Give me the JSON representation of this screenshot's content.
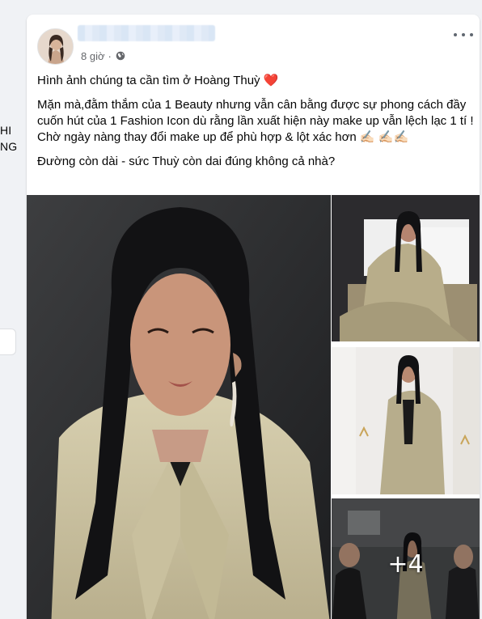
{
  "left_sidebar": {
    "fragment_1": "HI",
    "fragment_2": "NG"
  },
  "post": {
    "author_name": "████████████",
    "timestamp": "8 giờ",
    "separator": "·",
    "privacy_icon": "globe-icon",
    "more_icon": "more-horizontal-icon",
    "paragraphs": [
      "Hình ảnh chúng ta cần tìm ở Hoàng Thuỳ",
      "Mặn mà,đằm thắm của 1 Beauty nhưng vẫn cân bằng được sự phong cách đầy cuốn hút của 1 Fashion Icon dù rằng lần xuất hiện này make up vẫn lệch lạc 1 tí ! Chờ ngày nàng thay đổi make up để phù hợp & lột xác hơn ✍🏻 ✍🏻✍🏻",
      "Đường còn dài - sức Thuỳ còn dai đúng không cả nhà?"
    ],
    "heart_emoji": "❤️",
    "photos": {
      "more_count": "+4"
    }
  },
  "colors": {
    "background": "#f0f2f5",
    "card": "#ffffff",
    "text_primary": "#050505",
    "text_secondary": "#65676b",
    "heart": "#e0245e"
  }
}
